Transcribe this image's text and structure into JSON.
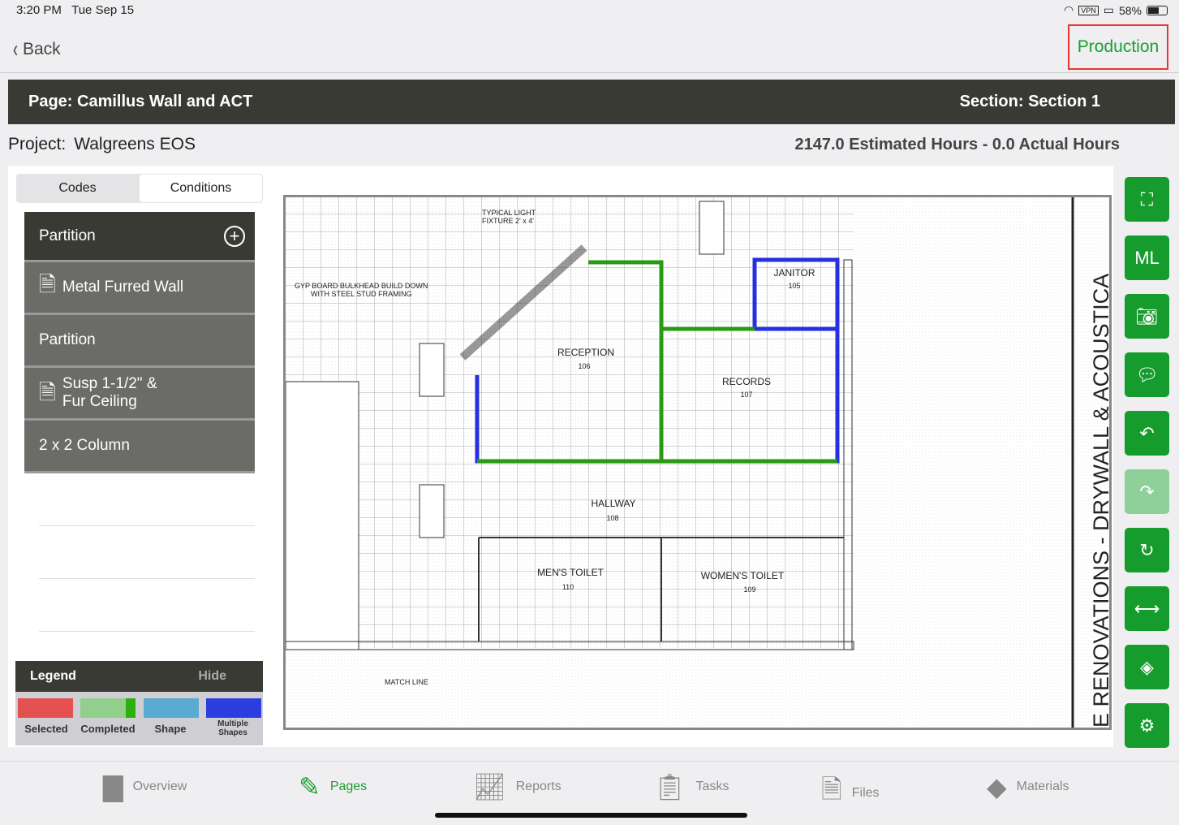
{
  "status": {
    "time": "3:20 PM",
    "date": "Tue Sep 15",
    "vpn": "VPN",
    "battery": "58%",
    "battery_level": 0.58
  },
  "nav": {
    "back": "Back",
    "production": "Production"
  },
  "header": {
    "page": "Page: Camillus Wall and ACT",
    "section": "Section: Section 1"
  },
  "project": {
    "label": "Project:",
    "name": "Walgreens EOS",
    "hours": "2147.0 Estimated Hours - 0.0 Actual Hours"
  },
  "tabs": [
    "Codes",
    "Conditions"
  ],
  "conditions": {
    "group": "Partition",
    "items": [
      {
        "label": "Metal Furred Wall",
        "icon": true
      },
      {
        "label": "Partition",
        "icon": false
      },
      {
        "label": "Susp 1-1/2\" &",
        "label2": "Fur Ceiling",
        "icon": true
      },
      {
        "label": "2 x 2  Column",
        "icon": false
      }
    ]
  },
  "legend": {
    "title": "Legend",
    "hide": "Hide",
    "items": [
      {
        "label": "Selected",
        "color": "#e55050"
      },
      {
        "label": "Completed",
        "color": "#93cf8c"
      },
      {
        "label": "Shape",
        "color": "#5aaad2"
      },
      {
        "label": "Multiple Shapes",
        "color": "#2e3de0"
      }
    ]
  },
  "plan": {
    "rooms": [
      {
        "name": "RECEPTION",
        "num": "106"
      },
      {
        "name": "RECORDS",
        "num": "107"
      },
      {
        "name": "JANITOR",
        "num": "105"
      },
      {
        "name": "HALLWAY",
        "num": "108"
      },
      {
        "name": "MEN'S TOILET",
        "num": "110"
      },
      {
        "name": "WOMEN'S TOILET",
        "num": "109"
      }
    ],
    "notes": [
      "TYPICAL LIGHT",
      "FIXTURE 2' x 4'",
      "GYP BOARD BULKHEAD BUILD DOWN",
      "WITH STEEL STUD FRAMING",
      "MATCH LINE",
      "E RENOVATIONS - DRYWALL & ACOUSTICA"
    ]
  },
  "tools": [
    "fullscreen",
    "ML",
    "camera",
    "comment",
    "undo",
    "redo",
    "refresh",
    "measure",
    "layers",
    "settings"
  ],
  "bottom": [
    "Overview",
    "Pages",
    "Reports",
    "Tasks",
    "Files",
    "Materials"
  ]
}
